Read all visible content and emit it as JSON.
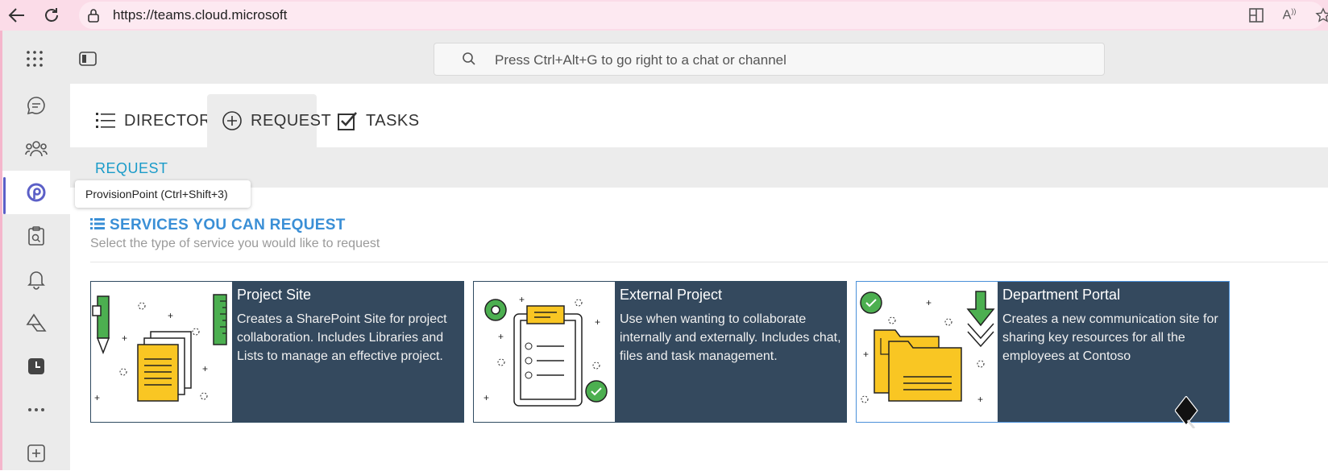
{
  "browser": {
    "url": "https://teams.cloud.microsoft"
  },
  "header": {
    "search_placeholder": "Press Ctrl+Alt+G to go right to a chat or channel"
  },
  "tooltip": "ProvisionPoint (Ctrl+Shift+3)",
  "tabs": [
    {
      "label": "DIRECTORY",
      "icon": "list-icon"
    },
    {
      "label": "REQUEST",
      "icon": "plus-circle-icon"
    },
    {
      "label": "TASKS",
      "icon": "checkbox-icon"
    }
  ],
  "subbar_title": "REQUEST",
  "section": {
    "title": "SERVICES YOU CAN REQUEST",
    "subtitle": "Select the type of service you would like to request"
  },
  "cards": [
    {
      "title": "Project Site",
      "description": "Creates a SharePoint Site for project collaboration. Includes Libraries and Lists to manage an effective project."
    },
    {
      "title": "External Project",
      "description": "Use when wanting to collaborate internally and externally. Includes chat, files and task management."
    },
    {
      "title": "Department Portal",
      "description": "Creates a new communication site for sharing key resources for all the employees at Contoso"
    }
  ],
  "colors": {
    "accent": "#5b5fc7",
    "card_bg": "#34495e",
    "link_blue": "#1a9bc9",
    "section_blue": "#3a8fd6"
  }
}
